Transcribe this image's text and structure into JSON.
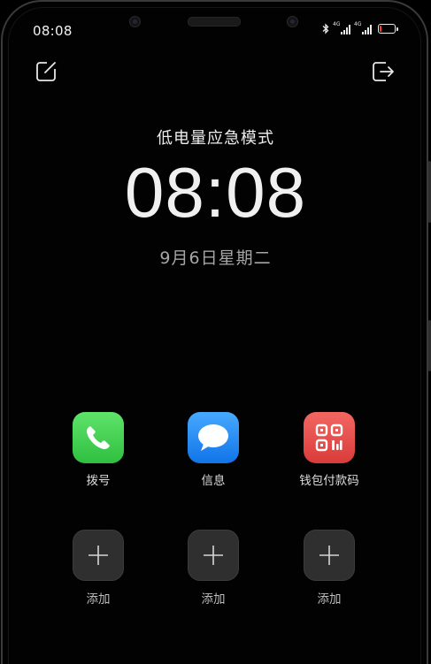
{
  "status_bar": {
    "time": "08:08",
    "network_type_1": "4G",
    "network_type_2": "4G",
    "icons": [
      "bluetooth-icon",
      "signal-icon",
      "signal-icon",
      "battery-icon"
    ],
    "battery_level": 0.12,
    "battery_color": "#ff3b30"
  },
  "top_actions": {
    "left_icon": "edit-icon",
    "right_icon": "exit-icon"
  },
  "lock": {
    "mode_title": "低电量应急模式",
    "clock": "08:08",
    "date": "9月6日星期二"
  },
  "apps": [
    {
      "label": "拨号",
      "icon": "phone-icon",
      "color": "#34c759"
    },
    {
      "label": "信息",
      "icon": "message-icon",
      "color": "#1a84f0"
    },
    {
      "label": "钱包付款码",
      "icon": "qr-code-icon",
      "color": "#e04846"
    }
  ],
  "add_slots": [
    {
      "label": "添加",
      "icon": "plus-icon"
    },
    {
      "label": "添加",
      "icon": "plus-icon"
    },
    {
      "label": "添加",
      "icon": "plus-icon"
    }
  ]
}
